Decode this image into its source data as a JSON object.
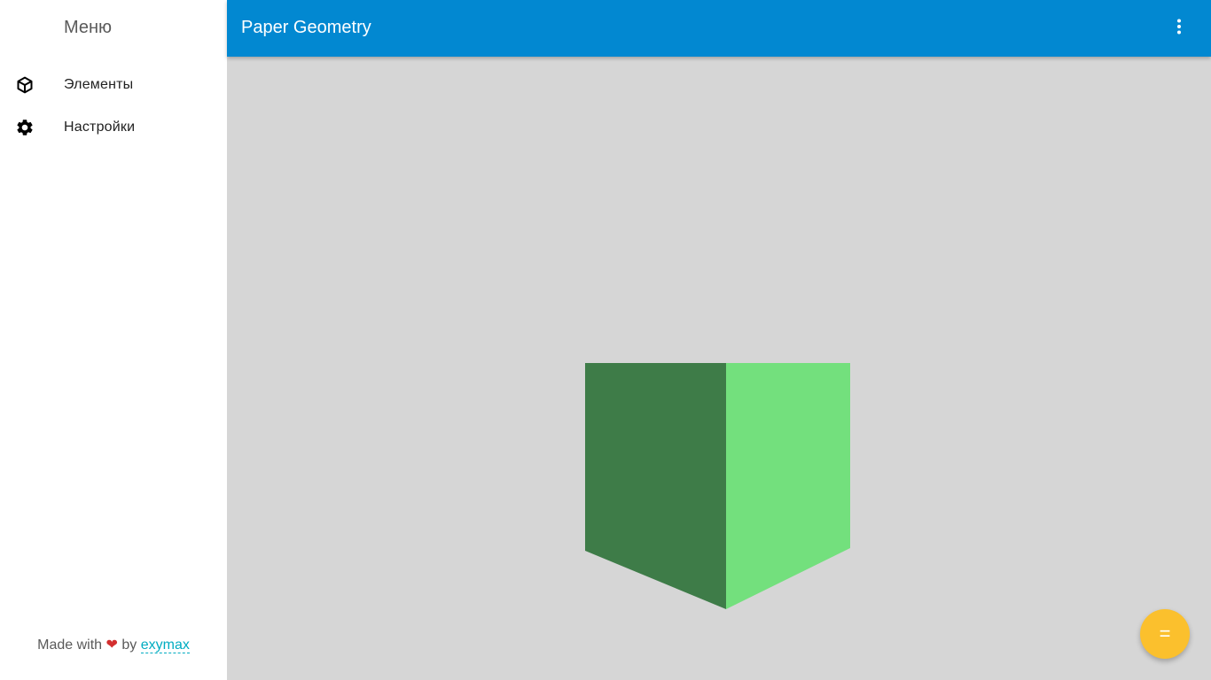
{
  "sidebar": {
    "title": "Меню",
    "items": [
      {
        "label": "Элементы",
        "icon": "cube-icon"
      },
      {
        "label": "Настройки",
        "icon": "gear-icon"
      }
    ],
    "footer": {
      "made_with": "Made with",
      "heart": "❤",
      "by": "by",
      "author": "exymax"
    }
  },
  "appbar": {
    "title": "Paper Geometry",
    "menu_icon": "more-vert-icon",
    "color": "#0288d1"
  },
  "canvas": {
    "background": "#d6d6d6",
    "shape": "cube",
    "face_left_color": "#3e7c48",
    "face_right_color": "#73e07d"
  },
  "fab": {
    "label": "=",
    "color": "#fbc02d"
  }
}
